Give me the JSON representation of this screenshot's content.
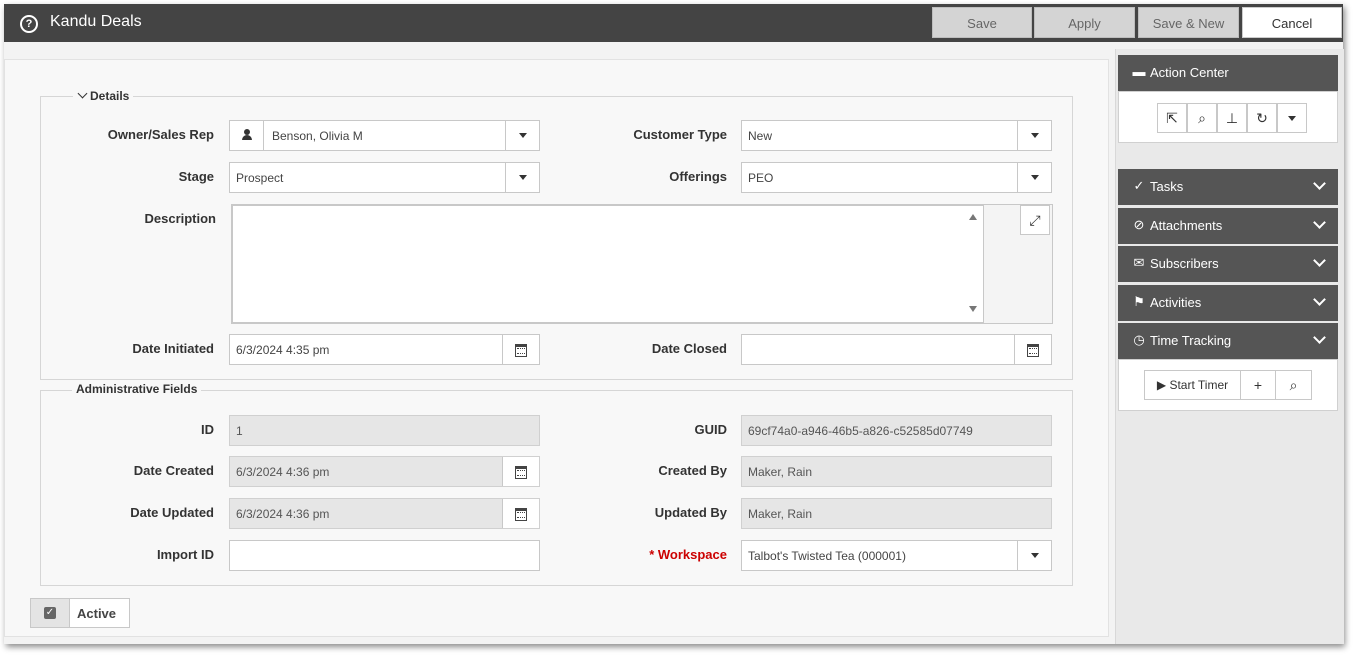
{
  "window": {
    "title": "Kandu Deals"
  },
  "toolbar": {
    "save": "Save",
    "apply": "Apply",
    "save_new": "Save & New",
    "cancel": "Cancel"
  },
  "details": {
    "legend": "Details",
    "owner_label": "Owner/Sales Rep",
    "owner_value": "Benson, Olivia M",
    "customer_type_label": "Customer Type",
    "customer_type_value": "New",
    "stage_label": "Stage",
    "stage_value": "Prospect",
    "offerings_label": "Offerings",
    "offerings_value": "PEO",
    "description_label": "Description",
    "description_value": "",
    "date_initiated_label": "Date Initiated",
    "date_initiated_value": "6/3/2024 4:35 pm",
    "date_closed_label": "Date Closed",
    "date_closed_value": ""
  },
  "admin": {
    "legend": "Administrative Fields",
    "id_label": "ID",
    "id_value": "1",
    "guid_label": "GUID",
    "guid_value": "69cf74a0-a946-46b5-a826-c52585d07749",
    "date_created_label": "Date Created",
    "date_created_value": "6/3/2024 4:36 pm",
    "created_by_label": "Created By",
    "created_by_value": "Maker, Rain",
    "date_updated_label": "Date Updated",
    "date_updated_value": "6/3/2024 4:36 pm",
    "updated_by_label": "Updated By",
    "updated_by_value": "Maker, Rain",
    "import_id_label": "Import ID",
    "import_id_value": "",
    "workspace_label": "* Workspace",
    "workspace_value": "Talbot's Twisted Tea (000001)"
  },
  "active": {
    "label": "Active",
    "checked": true
  },
  "sidebar": {
    "action_center": "Action Center",
    "tasks": "Tasks",
    "attachments": "Attachments",
    "subscribers": "Subscribers",
    "activities": "Activities",
    "time_tracking": "Time Tracking",
    "start_timer": "Start Timer"
  },
  "colors": {
    "titlebar": "#444444",
    "panel_header": "#555555",
    "required": "#cc0000"
  }
}
